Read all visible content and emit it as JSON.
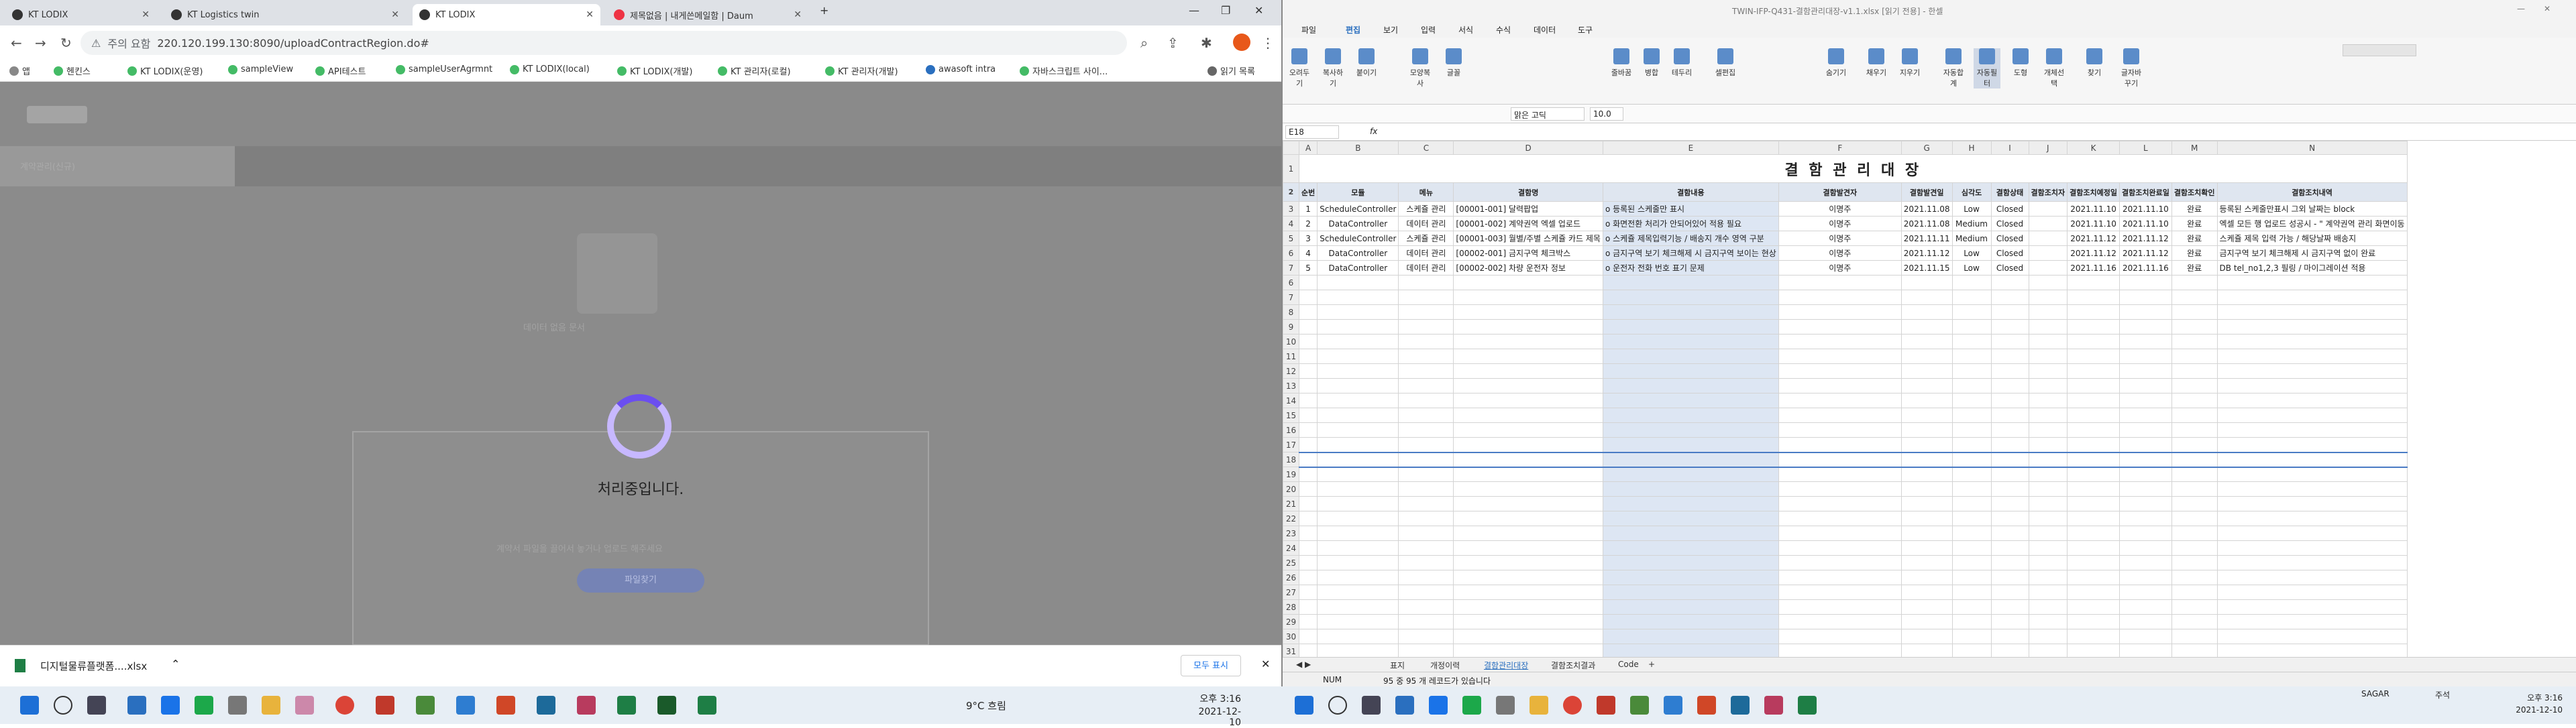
{
  "browser": {
    "tabs": [
      {
        "label": "KT LODIX"
      },
      {
        "label": "KT Logistics twin"
      },
      {
        "label": "KT LODIX"
      },
      {
        "label": "제목없음 | 내게쓴메일함 | Daum"
      }
    ],
    "address": {
      "security": "주의 요함",
      "url": "220.120.199.130:8090/uploadContractRegion.do#"
    },
    "bookmarks": [
      "앱",
      "헨킨스",
      "KT LODIX(운영)",
      "sampleView",
      "API테스트",
      "sampleUserAgrmnt",
      "KT LODIX(local)",
      "KT LODIX(개발)",
      "KT 관리자(로컬)",
      "KT 관리자(개발)",
      "awasoft intra",
      "자바스크립트 사이...",
      "읽기 목록"
    ]
  },
  "page": {
    "processing": "처리중입니다.",
    "bg_texts": [
      "계약관리(신규)",
      "데이터 없음 문서",
      "계약서 파일을 끌어서 놓거나 업로드 해주세요",
      "파일찾기"
    ]
  },
  "downloads": {
    "file": "디지털물류플랫폼....xlsx",
    "show_all": "모두 표시"
  },
  "taskbar_left": {
    "weather": "9°C 흐림",
    "time": "오후 3:16",
    "date": "2021-12-10"
  },
  "taskbar_right": {
    "time": "오후 3:16",
    "date": "2021-12-10",
    "search": "SAGAR",
    "mail": "주석"
  },
  "excel": {
    "title": "TWIN-IFP-Q431-결함관리대장-v1.1.xlsx [읽기 전용] - 한셀",
    "menus": [
      "파일",
      "편집",
      "보기",
      "입력",
      "서식",
      "수식",
      "데이터",
      "도구"
    ],
    "ribbon": [
      "오려두기",
      "복사하기",
      "붙이기",
      "모양복사",
      "글꼴",
      "줄바꿈",
      "병합",
      "테두리",
      "셀편집",
      "숨기기",
      "채우기",
      "지우기",
      "자동합계",
      "자동필터",
      "도형",
      "개체선택",
      "찾기",
      "글자바꾸기"
    ],
    "font": "맑은 고딕",
    "font_size": "10.0",
    "cell_ref": "E18",
    "fx": "fx",
    "columns": [
      "A",
      "B",
      "C",
      "D",
      "E",
      "F",
      "G",
      "H",
      "I",
      "J",
      "K",
      "L",
      "M",
      "N"
    ],
    "sheet_title": "결 함 관 리 대 장",
    "headers": [
      "순번",
      "모듈",
      "메뉴",
      "결함명",
      "결함내용",
      "결함발견자",
      "결함발견일",
      "심각도",
      "결함상태",
      "결함조치자",
      "결함조치예정일",
      "결함조치완료일",
      "결함조치확인",
      "결함조치내역"
    ],
    "rows": [
      [
        "1",
        "ScheduleController",
        "스케쥴 관리",
        "[00001-001] 달력팝업",
        "o 등록된 스케줄만 표시",
        "이명주",
        "2021.11.08",
        "Low",
        "Closed",
        "",
        "2021.11.10",
        "2021.11.10",
        "완료",
        "등록된 스케줄만표시 그외 날짜는 block"
      ],
      [
        "2",
        "DataController",
        "데이터 관리",
        "[00001-002] 계약권역 엑셀 업로드",
        "o 화면전환 처리가 안되어있어 적용 필요",
        "이명주",
        "2021.11.08",
        "Medium",
        "Closed",
        "",
        "2021.11.10",
        "2021.11.10",
        "완료",
        "엑셀 모든 행 업로드 성공시 - \" 계약권역 관리 화면이동"
      ],
      [
        "3",
        "ScheduleController",
        "스케쥴 관리",
        "[00001-003] 월별/주별 스케쥴 카드 제목",
        "o 스케쥴 제목입력기능 / 배송지 개수 영역 구분",
        "이명주",
        "2021.11.11",
        "Medium",
        "Closed",
        "",
        "2021.11.12",
        "2021.11.12",
        "완료",
        "스케쥴 제목 입력 가능 / 해당날짜 배송지"
      ],
      [
        "4",
        "DataController",
        "데이터 관리",
        "[00002-001] 금지구역 체크박스",
        "o 금지구역 보기 체크해제 시 금지구역 보이는 현상",
        "이명주",
        "2021.11.12",
        "Low",
        "Closed",
        "",
        "2021.11.12",
        "2021.11.12",
        "완료",
        "금지구역 보기 체크해제 시 금지구역 없이 완료"
      ],
      [
        "5",
        "DataController",
        "데이터 관리",
        "[00002-002] 차량 운전자 정보",
        "o 운전자 전화 번호 표기 문제",
        "이명주",
        "2021.11.15",
        "Low",
        "Closed",
        "",
        "2021.11.16",
        "2021.11.16",
        "완료",
        "DB tel_no1,2,3 필링 / 마이그레이션 적용"
      ]
    ],
    "empty_rows": [
      "6",
      "7",
      "8",
      "9",
      "10",
      "11",
      "12",
      "13",
      "14",
      "15",
      "16",
      "17",
      "18",
      "19",
      "20",
      "21",
      "22",
      "23",
      "24",
      "25",
      "26",
      "27",
      "28",
      "29",
      "30",
      "31"
    ],
    "sheet_tabs": [
      "표지",
      "개정이력",
      "결함관리대장",
      "결함조치결과",
      "Code"
    ],
    "active_tab": "결함관리대장",
    "status": {
      "mode": "NUM",
      "msg": "95 중 95 개 레코드가 있습니다"
    }
  },
  "colors": {
    "accent": "#2a6fbf",
    "spinner": "#6b4ef0"
  }
}
